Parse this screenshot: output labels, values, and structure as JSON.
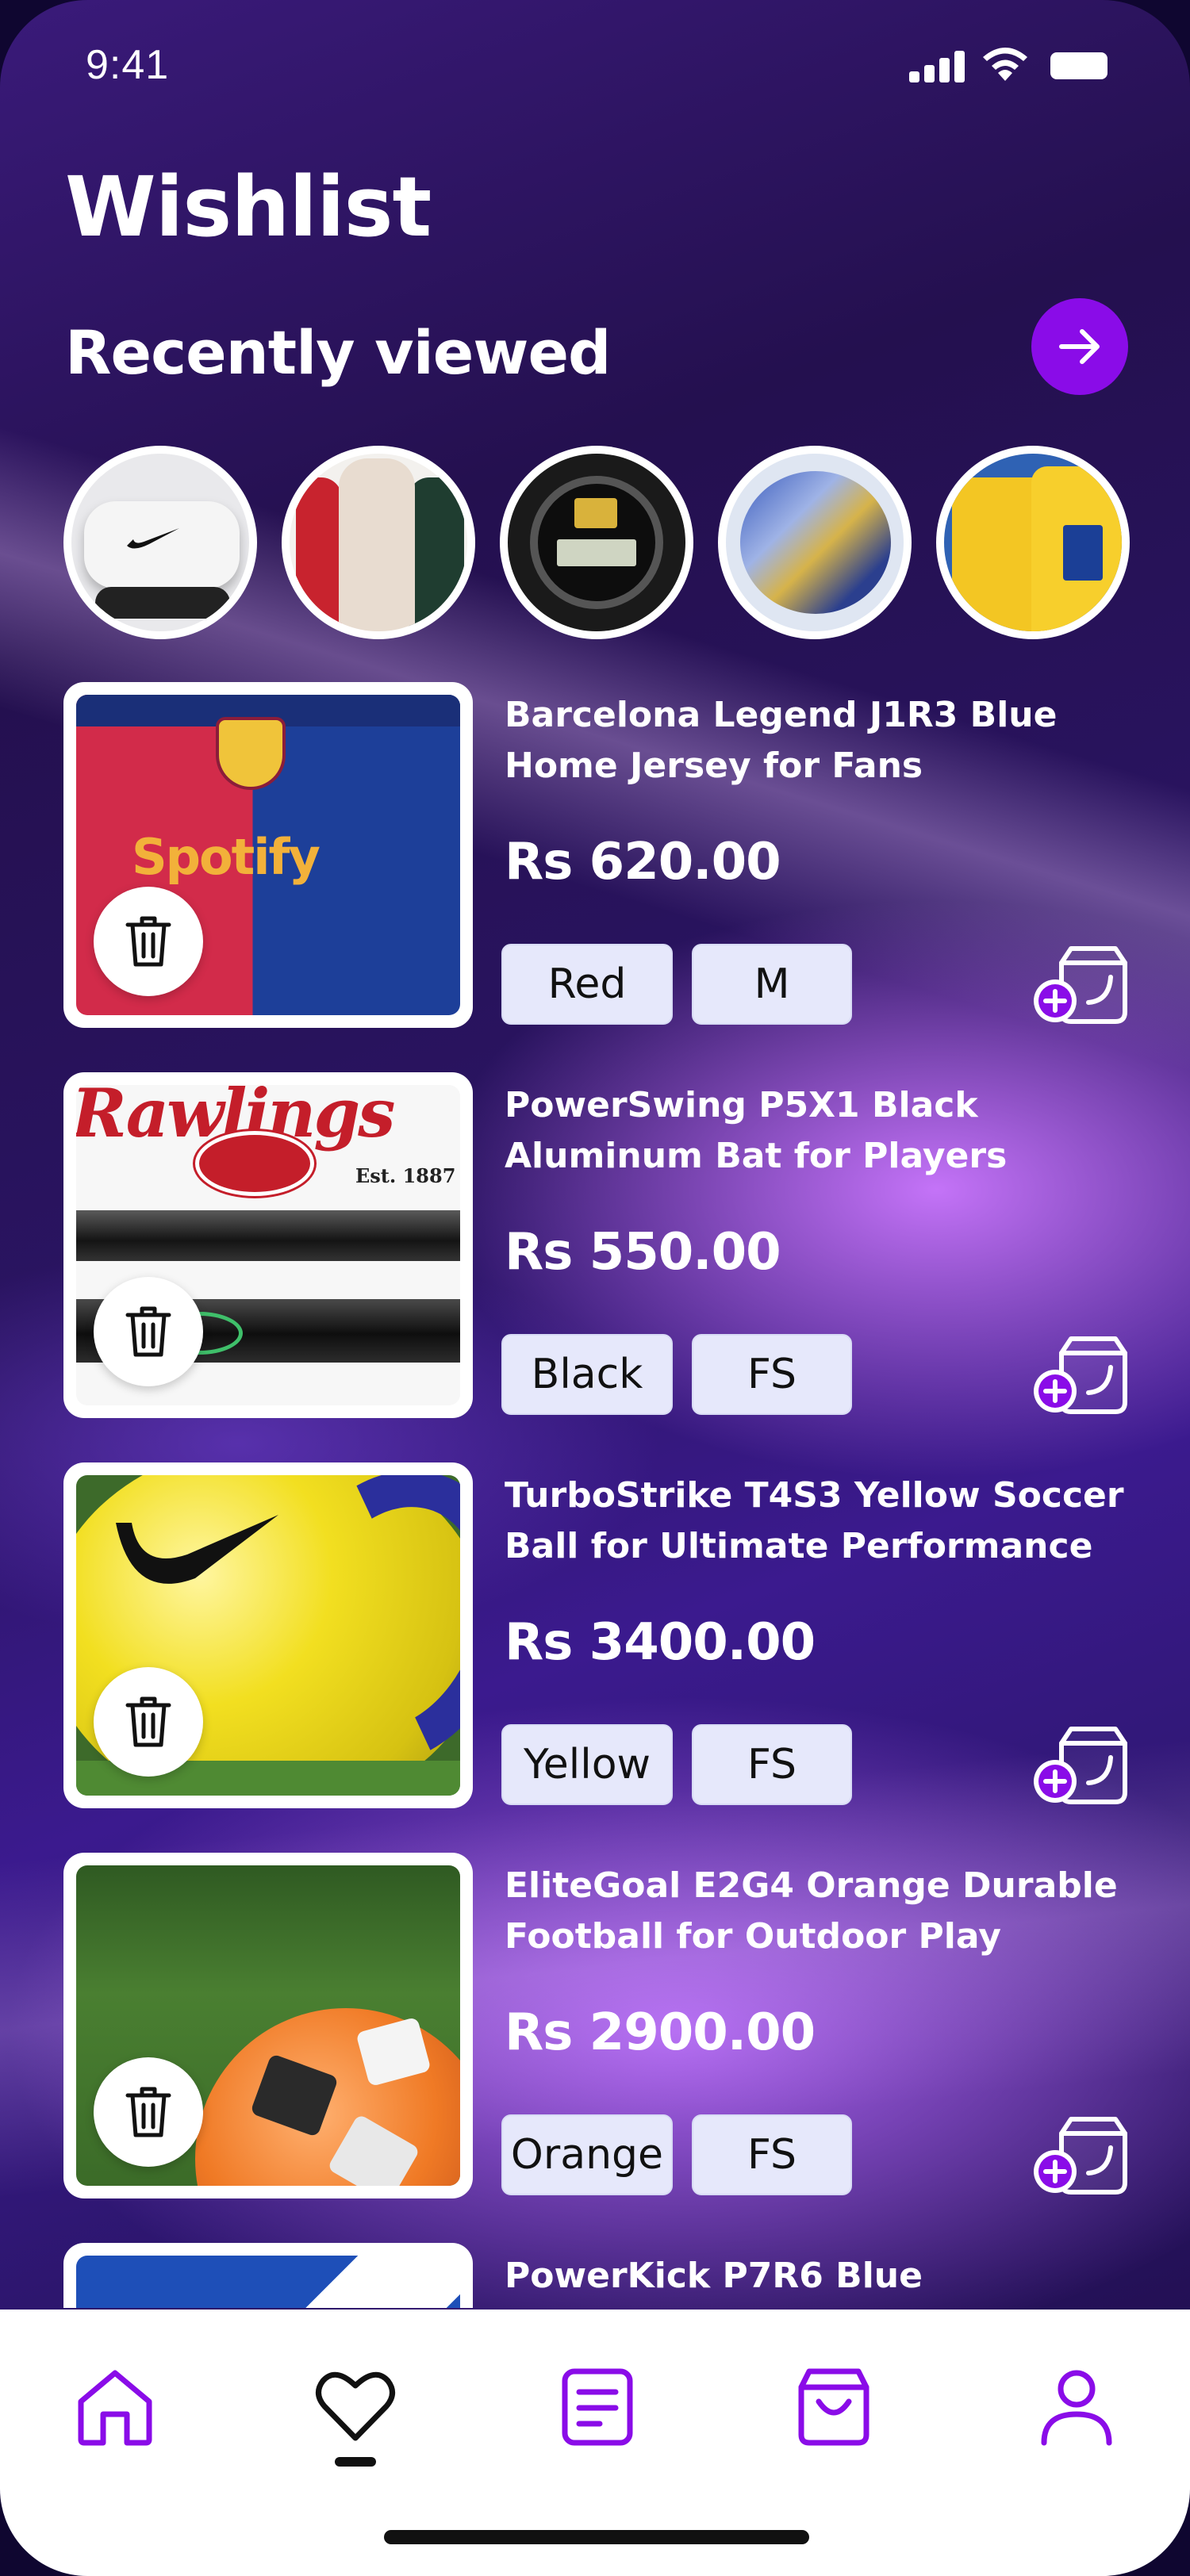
{
  "status_bar": {
    "time": "9:41"
  },
  "header": {
    "title": "Wishlist"
  },
  "recently_viewed": {
    "title": "Recently viewed",
    "items": [
      {
        "name": "headband"
      },
      {
        "name": "water-bottles"
      },
      {
        "name": "sports-watch"
      },
      {
        "name": "camo-ball"
      },
      {
        "name": "yellow-jersey"
      }
    ]
  },
  "wishlist": [
    {
      "name": "Barcelona Legend J1R3 Blue Home Jersey for Fans",
      "price": "Rs 620.00",
      "color": "Red",
      "size": "M"
    },
    {
      "name": "PowerSwing P5X1 Black Aluminum Bat for Players",
      "price": "Rs 550.00",
      "color": "Black",
      "size": "FS"
    },
    {
      "name": "TurboStrike T4S3 Yellow Soccer Ball for Ultimate Performance",
      "price": "Rs 3400.00",
      "color": "Yellow",
      "size": "FS"
    },
    {
      "name": "EliteGoal E2G4 Orange Durable Football for Outdoor Play",
      "price": "Rs 2900.00",
      "color": "Orange",
      "size": "FS"
    },
    {
      "name": "PowerKick P7R6 Blue",
      "price": "",
      "color": "",
      "size": ""
    }
  ],
  "thumb_texts": {
    "jersey_sponsor": "Spotify",
    "bat_brand": "Rawlings",
    "bat_est": "Est. 1887"
  },
  "nav": {
    "items": [
      {
        "name": "home",
        "icon": "home-icon"
      },
      {
        "name": "wishlist",
        "icon": "heart-icon",
        "active": true
      },
      {
        "name": "orders",
        "icon": "list-icon"
      },
      {
        "name": "cart",
        "icon": "bag-icon"
      },
      {
        "name": "profile",
        "icon": "user-icon"
      }
    ]
  },
  "colors": {
    "accent": "#8a0ce8",
    "chip_bg": "#e6e8fb",
    "text": "#ffffff"
  }
}
